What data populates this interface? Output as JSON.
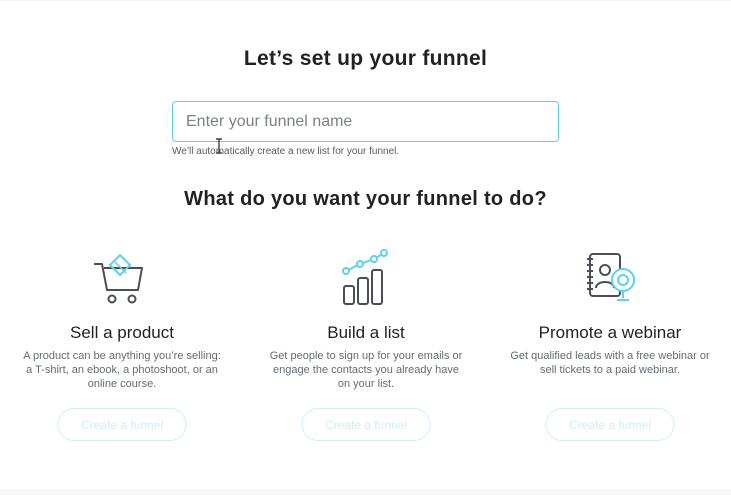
{
  "setup": {
    "title": "Let’s set up your funnel",
    "input_placeholder": "Enter your funnel name",
    "input_value": "",
    "hint": "We’ll automatically create a new list for your funnel."
  },
  "goal": {
    "title": "What do you want your funnel to do?"
  },
  "options": [
    {
      "icon": "shopping-cart-icon",
      "title": "Sell a product",
      "description": "A product can be anything you’re selling: a T-shirt, an ebook, a photoshoot, or an online course.",
      "button": "Create a funnel"
    },
    {
      "icon": "growth-chart-icon",
      "title": "Build a list",
      "description": "Get people to sign up for your emails or engage the contacts you already have on your list.",
      "button": "Create a funnel"
    },
    {
      "icon": "webcam-notebook-icon",
      "title": "Promote a webinar",
      "description": "Get qualified leads with a free webinar or sell tickets to a paid webinar.",
      "button": "Create a funnel"
    }
  ],
  "colors": {
    "accent": "#5bd2ee",
    "icon_stroke": "#4a4f55",
    "button_disabled": "#cbeef7"
  }
}
